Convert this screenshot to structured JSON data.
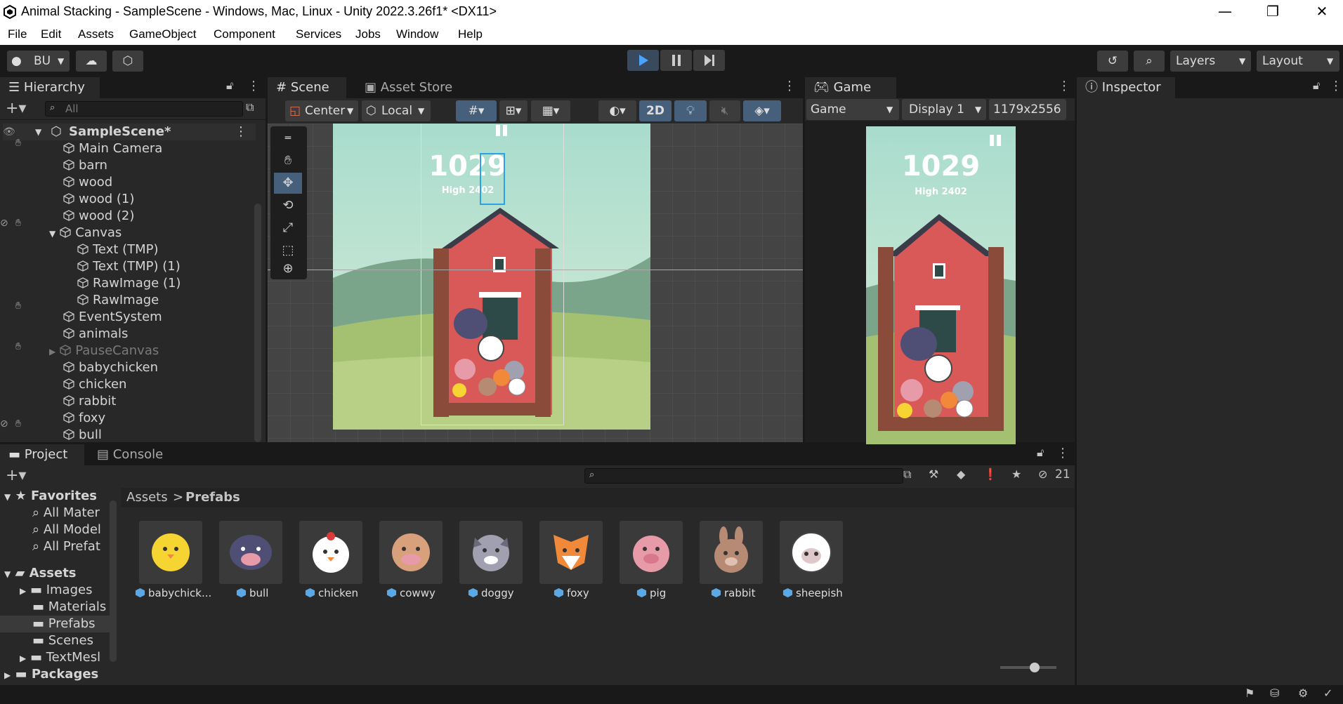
{
  "window": {
    "title": "Animal Stacking - SampleScene - Windows, Mac, Linux - Unity 2022.3.26f1* <DX11>",
    "minimize": "—",
    "maximize": "❐",
    "close": "✕"
  },
  "menu": [
    "File",
    "Edit",
    "Assets",
    "GameObject",
    "Component",
    "Services",
    "Jobs",
    "Window",
    "Help"
  ],
  "toolbar": {
    "account": "BU",
    "layers": "Layers",
    "layout": "Layout"
  },
  "hierarchy": {
    "tab": "Hierarchy",
    "search_placeholder": "All",
    "scene": "SampleScene*",
    "items": [
      {
        "label": "Main Camera"
      },
      {
        "label": "barn"
      },
      {
        "label": "wood"
      },
      {
        "label": "wood (1)"
      },
      {
        "label": "wood (2)"
      },
      {
        "label": "Canvas"
      },
      {
        "label": "Text (TMP)"
      },
      {
        "label": "Text (TMP) (1)"
      },
      {
        "label": "RawImage (1)"
      },
      {
        "label": "RawImage"
      },
      {
        "label": "EventSystem"
      },
      {
        "label": "animals"
      },
      {
        "label": "PauseCanvas"
      },
      {
        "label": "babychicken"
      },
      {
        "label": "chicken"
      },
      {
        "label": "rabbit"
      },
      {
        "label": "foxy"
      },
      {
        "label": "bull"
      }
    ]
  },
  "scene": {
    "tab_scene": "Scene",
    "tab_store": "Asset Store",
    "pivot": "Center",
    "space": "Local",
    "mode2d": "2D",
    "score": "1029",
    "high": "High 2402"
  },
  "game": {
    "tab": "Game",
    "view": "Game",
    "display": "Display 1",
    "resolution": "1179x2556",
    "score": "1029",
    "high": "High 2402"
  },
  "inspector": {
    "tab": "Inspector"
  },
  "project": {
    "tab_project": "Project",
    "tab_console": "Console",
    "hidden_count": "21",
    "breadcrumb_root": "Assets",
    "breadcrumb_sep": ">",
    "breadcrumb_current": "Prefabs",
    "favorites": "Favorites",
    "fav_items": [
      "All Mater",
      "All Model",
      "All Prefat"
    ],
    "assets_root": "Assets",
    "folders": [
      "Images",
      "Materials",
      "Prefabs",
      "Scenes",
      "TextMesl"
    ],
    "packages": "Packages",
    "prefabs": [
      "babychick...",
      "bull",
      "chicken",
      "cowwy",
      "doggy",
      "foxy",
      "pig",
      "rabbit",
      "sheepish"
    ]
  },
  "colors": {
    "accent": "#46607c",
    "panel": "#282828",
    "background": "#191919"
  }
}
